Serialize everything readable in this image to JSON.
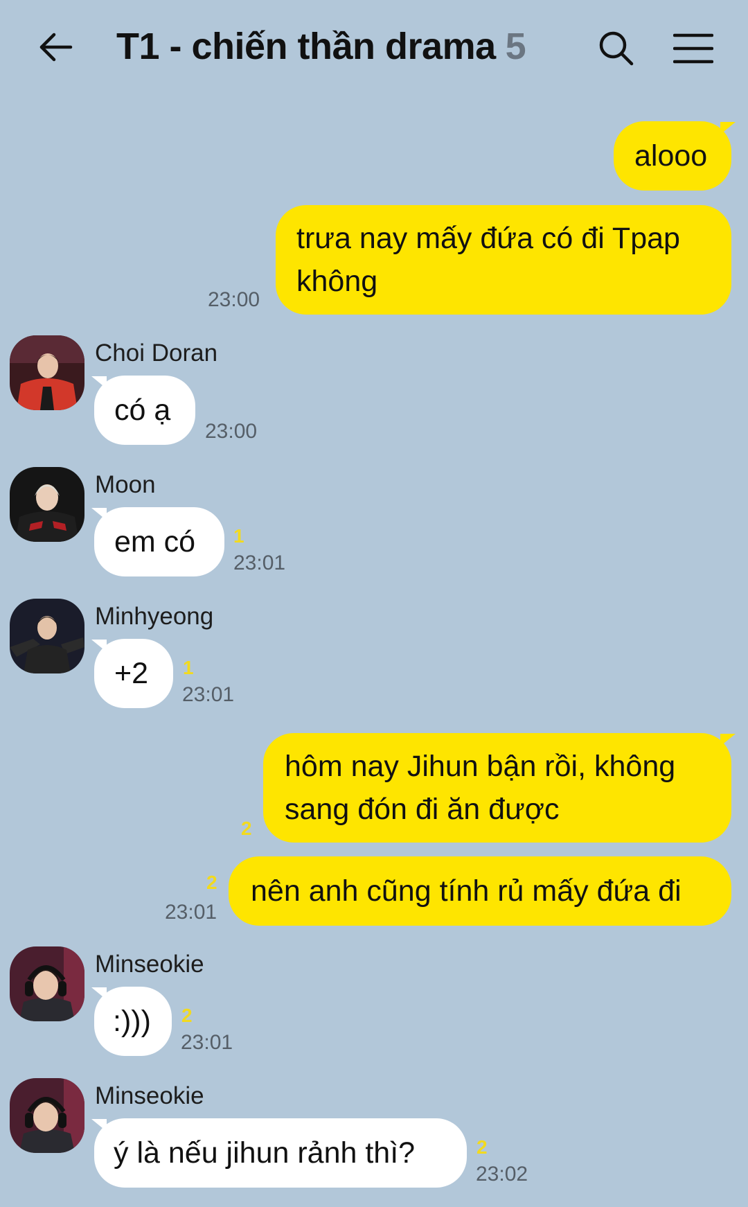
{
  "header": {
    "title": "T1 - chiến thần drama",
    "member_count": "5"
  },
  "messages": {
    "m1": {
      "text": "alooo"
    },
    "m2": {
      "line1": "trưa nay mấy đứa có đi Tpap",
      "line2": "không",
      "time": "23:00"
    },
    "m3": {
      "sender": "Choi Doran",
      "text": "có ạ",
      "time": "23:00"
    },
    "m4": {
      "sender": "Moon",
      "text": "em có",
      "unread": "1",
      "time": "23:01"
    },
    "m5": {
      "sender": "Minhyeong",
      "text": "+2",
      "unread": "1",
      "time": "23:01"
    },
    "m6": {
      "line1": "hôm nay Jihun bận rồi, không",
      "line2": "sang đón đi ăn được",
      "unread": "2"
    },
    "m7": {
      "text": "nên anh cũng tính rủ mấy đứa đi",
      "unread": "2",
      "time": "23:01"
    },
    "m8": {
      "sender": "Minseokie",
      "text": ":)))",
      "unread": "2",
      "time": "23:01"
    },
    "m9": {
      "sender": "Minseokie",
      "text": "ý là nếu jihun rảnh thì?",
      "unread": "2",
      "time": "23:02"
    }
  },
  "colors": {
    "background": "#b2c7d9",
    "outgoing_bubble": "#fee500",
    "incoming_bubble": "#ffffff",
    "unread_count": "#f2da1f"
  },
  "icons": {
    "back": "arrow-left-icon",
    "search": "search-icon",
    "menu": "hamburger-menu-icon"
  }
}
